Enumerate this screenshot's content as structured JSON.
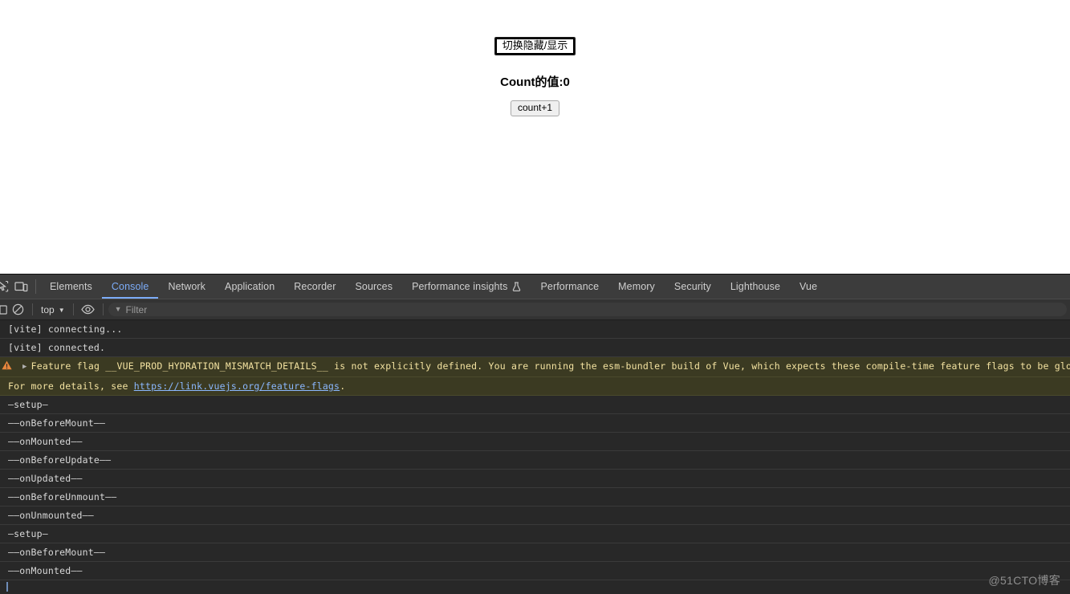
{
  "page": {
    "toggle_button_label": "切换隐藏/显示",
    "count_title": "Count的值:0",
    "increment_button_label": "count+1"
  },
  "devtools": {
    "tabs": [
      {
        "label": "Elements",
        "active": false
      },
      {
        "label": "Console",
        "active": true
      },
      {
        "label": "Network",
        "active": false
      },
      {
        "label": "Application",
        "active": false
      },
      {
        "label": "Recorder",
        "active": false
      },
      {
        "label": "Sources",
        "active": false
      },
      {
        "label": "Performance insights",
        "active": false,
        "experiment": true
      },
      {
        "label": "Performance",
        "active": false
      },
      {
        "label": "Memory",
        "active": false
      },
      {
        "label": "Security",
        "active": false
      },
      {
        "label": "Lighthouse",
        "active": false
      },
      {
        "label": "Vue",
        "active": false
      }
    ],
    "toolbar": {
      "inspect_icon": "inspect-cursor-icon",
      "device_icon": "device-toolbar-icon",
      "sidebar_icon": "console-sidebar-icon",
      "clear_icon": "clear-console-icon",
      "context_value": "top",
      "eye_icon": "live-expression-icon",
      "filter_placeholder": "Filter",
      "funnel_icon": "funnel-icon"
    },
    "console_messages": [
      {
        "type": "log",
        "text": "[vite] connecting..."
      },
      {
        "type": "log",
        "text": "[vite] connected."
      },
      {
        "type": "warn",
        "expandable": true,
        "text": "Feature flag __VUE_PROD_HYDRATION_MISMATCH_DETAILS__ is not explicitly defined. You are running the esm-bundler build of Vue, which expects these compile-time feature flags to be globally injected via the bundler confi"
      },
      {
        "type": "warn_cont",
        "prefix": "For more details, see ",
        "link": "https://link.vuejs.org/feature-flags",
        "suffix": "."
      },
      {
        "type": "log",
        "text": "—setup—"
      },
      {
        "type": "log",
        "text": "——onBeforeMount——"
      },
      {
        "type": "log",
        "text": "——onMounted——"
      },
      {
        "type": "log",
        "text": "——onBeforeUpdate——"
      },
      {
        "type": "log",
        "text": "——onUpdated——"
      },
      {
        "type": "log",
        "text": "——onBeforeUnmount——"
      },
      {
        "type": "log",
        "text": "——onUnmounted——"
      },
      {
        "type": "log",
        "text": "—setup—"
      },
      {
        "type": "log",
        "text": "——onBeforeMount——"
      },
      {
        "type": "log",
        "text": "——onMounted——"
      }
    ]
  },
  "watermark": "@51CTO博客",
  "colors": {
    "accent": "#7cacf8",
    "warning_bg": "#3b3a22",
    "warning_text": "#f3e2a0",
    "console_bg": "#282828",
    "toolbar_bg": "#333333",
    "tabstrip_bg": "#3c3c3c",
    "link": "#8bb8ff"
  }
}
